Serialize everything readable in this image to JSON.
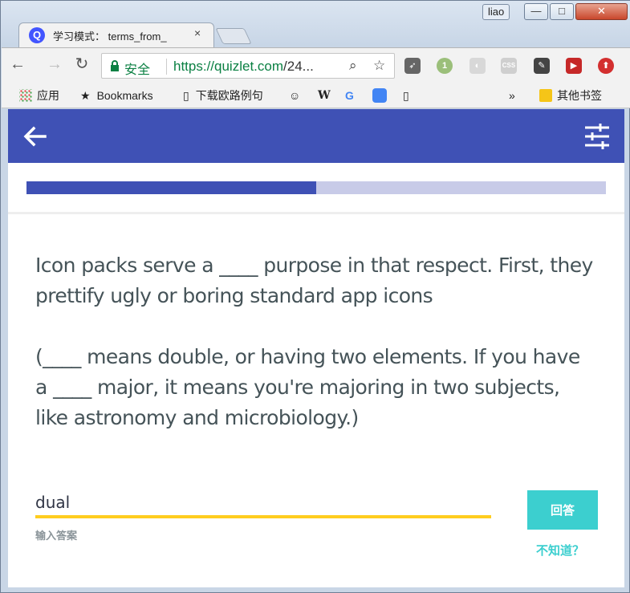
{
  "window": {
    "user_badge": "liao",
    "minimize_label": "—",
    "maximize_label": "□",
    "close_label": "✕"
  },
  "tab": {
    "title": "学习模式： terms_from_",
    "close_label": "×"
  },
  "toolbar": {
    "secure_label": "安全",
    "url_scheme_host": "https://quizlet.com",
    "url_path": "/24...",
    "extensions": [
      {
        "name": "rocket-icon",
        "color": "#555555"
      },
      {
        "name": "extension-badge-icon",
        "badge": "1",
        "color": "#f0a830"
      },
      {
        "name": "css-icon",
        "label": "CSS",
        "color": "#bbbbbb"
      },
      {
        "name": "evernote-icon",
        "color": "#333333"
      },
      {
        "name": "media-icon",
        "color": "#d42b2b"
      },
      {
        "name": "upload-icon",
        "color": "#d42b2b"
      }
    ]
  },
  "bookmarks": {
    "apps_label": "应用",
    "bookmarks_label": "Bookmarks",
    "download_label": "下载欧路例句",
    "wiki_label": "W",
    "google_label": "G",
    "more_label": "»",
    "other_label": "其他书签"
  },
  "quiz": {
    "prompt": "Icon packs serve a ____ purpose in that respect. First, they prettify ugly or boring standard app icons\n\n(____ means double, or having two elements. If you have a ____ major, it means you're majoring in two subjects, like astronomy and microbiology.)",
    "progress": 0.5,
    "answer_value": "dual",
    "input_label": "输入答案",
    "answer_button": "回答",
    "dont_know": "不知道？"
  },
  "colors": {
    "header": "#3f51b5",
    "progress_track": "#c8cbe8",
    "input_underline": "#ffcd1f",
    "accent_teal": "#3ccfcf"
  }
}
